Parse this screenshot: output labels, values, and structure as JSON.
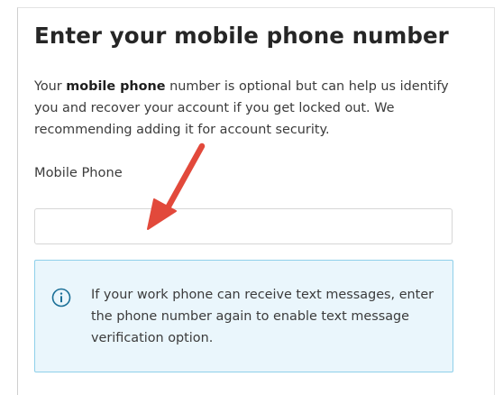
{
  "page": {
    "title": "Enter your mobile phone number",
    "description": {
      "prefix": "Your ",
      "emphasis": "mobile phone",
      "suffix": " number is optional but can help us identify you and recover your account if you get locked out. We recommending adding it for account security."
    },
    "mobile_phone": {
      "label": "Mobile Phone",
      "value": "",
      "placeholder": ""
    },
    "info_box": {
      "icon": "info-circle-icon",
      "text": "If your work phone can receive text messages, enter the phone number again to enable text message verification option."
    },
    "annotation": {
      "icon": "red-arrow-icon"
    }
  },
  "colors": {
    "title_text": "#262626",
    "body_text": "#3b3b3b",
    "info_background": "#eaf6fc",
    "info_border": "#8fd0ea",
    "info_icon": "#1a6f97",
    "arrow": "#e2493b"
  }
}
